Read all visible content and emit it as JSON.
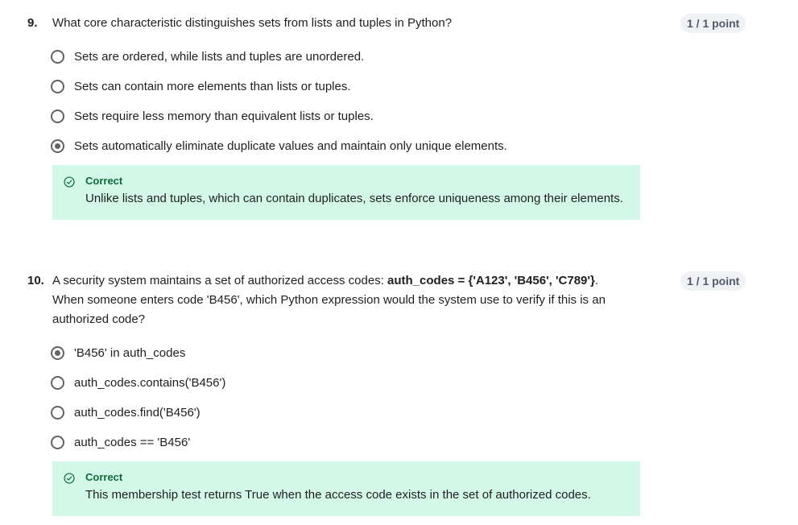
{
  "questions": [
    {
      "number": "9.",
      "text": "What core characteristic distinguishes sets from lists and tuples in Python?",
      "points": "1 / 1 point",
      "options": [
        {
          "label": "Sets are ordered, while lists and tuples are unordered.",
          "selected": false
        },
        {
          "label": "Sets can contain more elements than lists or tuples.",
          "selected": false
        },
        {
          "label": "Sets require less memory than equivalent lists or tuples.",
          "selected": false
        },
        {
          "label": "Sets automatically eliminate duplicate values and maintain only unique elements.",
          "selected": true
        }
      ],
      "feedback": {
        "status": "Correct",
        "icon": "check-circle-icon",
        "text": "Unlike lists and tuples, which can contain duplicates, sets enforce uniqueness among their elements."
      }
    },
    {
      "number": "10.",
      "text_before": "A security system maintains a set of authorized access codes: ",
      "text_code": "auth_codes = {'A123', 'B456', 'C789'}",
      "text_after": ". When someone enters code 'B456', which Python expression would the system use to verify if this is an authorized code?",
      "points": "1 / 1 point",
      "options": [
        {
          "label": "'B456' in auth_codes",
          "selected": true
        },
        {
          "label": "auth_codes.contains('B456')",
          "selected": false
        },
        {
          "label": "auth_codes.find('B456')",
          "selected": false
        },
        {
          "label": "auth_codes == 'B456'",
          "selected": false
        }
      ],
      "feedback": {
        "status": "Correct",
        "icon": "check-circle-icon",
        "text": "This membership test returns True when the access code exists in the set of authorized codes."
      }
    }
  ],
  "colors": {
    "feedback_bg": "#d3f8e9",
    "feedback_title": "#0b6b3a",
    "badge_bg": "#f0f2f5",
    "radio": "#636363"
  }
}
